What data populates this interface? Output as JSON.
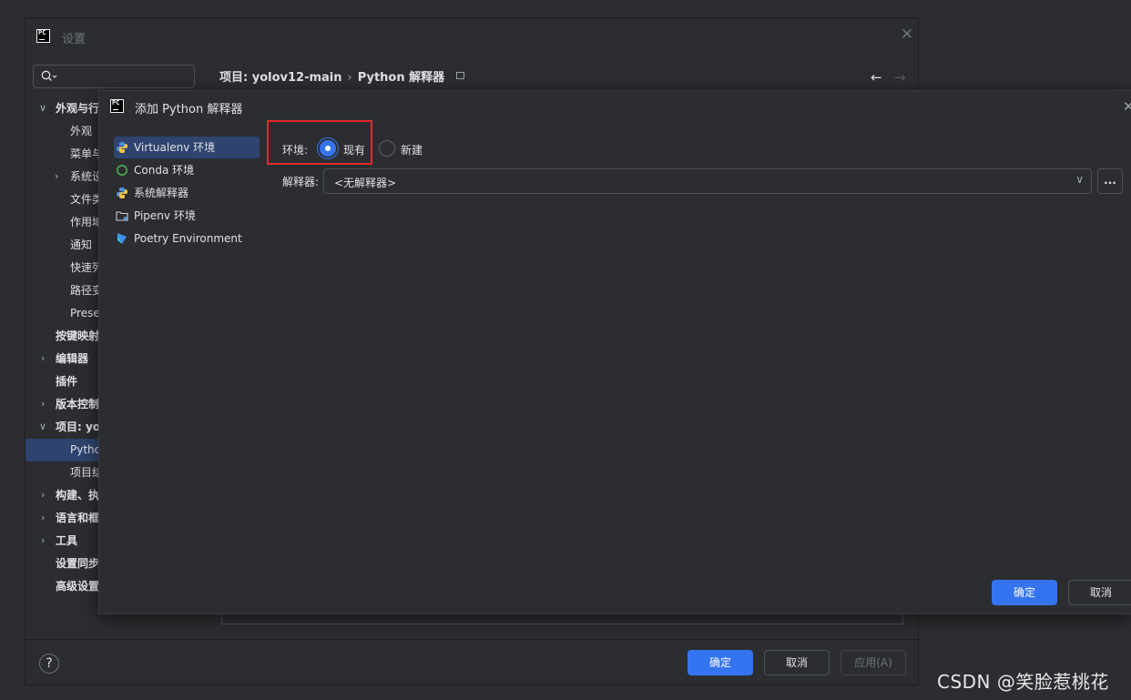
{
  "settings": {
    "title": "设置",
    "search": {
      "placeholder": ""
    },
    "tree": [
      "外观与行",
      "外观",
      "菜单与",
      "系统设",
      "文件类",
      "作用域",
      "通知",
      "快速列",
      "路径变",
      "Prese",
      "按键映射",
      "编辑器",
      "插件",
      "版本控制",
      "项目: yo",
      "Pytho",
      "项目结",
      "构建、执",
      "语言和框",
      "工具",
      "设置同步",
      "高级设置"
    ],
    "breadcrumb": {
      "project": "项目: yolov12-main",
      "separator": "›",
      "page": "Python 解释器"
    },
    "footer": {
      "ok": "确定",
      "cancel": "取消",
      "apply": "应用(A)",
      "help": "?"
    }
  },
  "dialog": {
    "title": "添加 Python 解释器",
    "environments": [
      {
        "label": "Virtualenv 环境",
        "icon": "python-icon",
        "selected": true
      },
      {
        "label": "Conda 环境",
        "icon": "conda-icon",
        "selected": false
      },
      {
        "label": "系统解释器",
        "icon": "python-icon",
        "selected": false
      },
      {
        "label": "Pipenv 环境",
        "icon": "pipenv-folder-icon",
        "selected": false
      },
      {
        "label": "Poetry Environment",
        "icon": "poetry-icon",
        "selected": false
      }
    ],
    "env_label": "环境:",
    "radio_existing": "现有",
    "radio_new": "新建",
    "selected_radio": "现有",
    "interpreter_label": "解释器:",
    "interpreter_value": "<无解释器>",
    "browse": "...",
    "ok": "确定",
    "cancel": "取消"
  },
  "colors": {
    "accent": "#3574f0",
    "highlight_box": "#e02b2b",
    "selection": "#2e436e"
  },
  "watermark": "CSDN @笑脸惹桃花"
}
